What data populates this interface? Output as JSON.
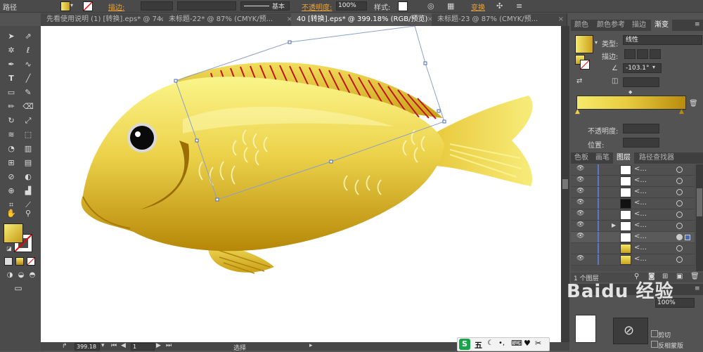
{
  "control_bar": {
    "object_type": "路径",
    "stroke_label": "描边:",
    "stroke_profile": "基本",
    "opacity_label": "不透明度:",
    "opacity_value": "100%",
    "style_label": "样式:",
    "transform_label": "变换"
  },
  "tabs": [
    {
      "label": "先看使用说明 (1) [转换].eps* @ 74...",
      "active": false
    },
    {
      "label": "未标题-22* @ 87% (CMYK/预...",
      "active": false
    },
    {
      "label": "40 [转换].eps* @ 399.18% (RGB/预览)",
      "active": true
    },
    {
      "label": "未标题-23 @ 87% (CMYK/预...",
      "active": false
    }
  ],
  "gradient_panel": {
    "tabs": [
      "颜色",
      "颜色参考",
      "描边",
      "渐变"
    ],
    "type_label": "类型:",
    "type_value": "线性",
    "stroke_label": "描边:",
    "angle_value": "-103.1°",
    "opacity_label": "不透明度:",
    "location_label": "位置:"
  },
  "layers_panel": {
    "tabs": [
      "色板",
      "画笔",
      "图层",
      "路径查找器"
    ],
    "rows": [
      {
        "name": "<..."
      },
      {
        "name": "<..."
      },
      {
        "name": "<..."
      },
      {
        "name": "<..."
      },
      {
        "name": "<..."
      },
      {
        "name": "<..."
      },
      {
        "name": "<..."
      },
      {
        "name": "<..."
      },
      {
        "name": "<..."
      }
    ],
    "footer_count": "1 个图层"
  },
  "transparency_panel": {
    "mask_label": "剪切",
    "invert_mask_label": "反相蒙版",
    "opacity_value": "100%"
  },
  "status_bar": {
    "zoom_value": "399.18",
    "page_value": "1",
    "tool_name": "选择"
  },
  "taskbar": {
    "ime_label": "五"
  },
  "watermark": "Baidu 经验",
  "colors": {
    "fish_light": "#f4e96a",
    "fish_mid": "#e3c22a",
    "fish_dark": "#b78a0c",
    "fin_stripes": "#c0141a",
    "accent_orange": "#e8a33d"
  }
}
